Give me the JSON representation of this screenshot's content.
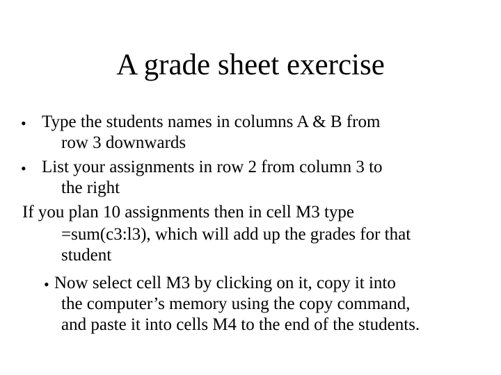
{
  "slide": {
    "title": "A grade sheet exercise",
    "items": [
      {
        "bullet": "•",
        "lines": [
          "Type the students names in columns A & B from",
          "row 3 downwards"
        ]
      },
      {
        "bullet": "•",
        "lines": [
          "List your assignments in row 2 from column 3 to",
          "the right"
        ]
      },
      {
        "bullet": "",
        "lines": [
          "If you plan 10 assignments then in cell M3 type",
          "=sum(c3:l3), which will add up the grades for that",
          "student"
        ]
      },
      {
        "bullet": "•",
        "lines": [
          "Now select cell M3 by clicking on it, copy it into",
          "the computer’s memory using the copy command,",
          "and paste it into cells M4 to the end of the students."
        ]
      }
    ]
  }
}
